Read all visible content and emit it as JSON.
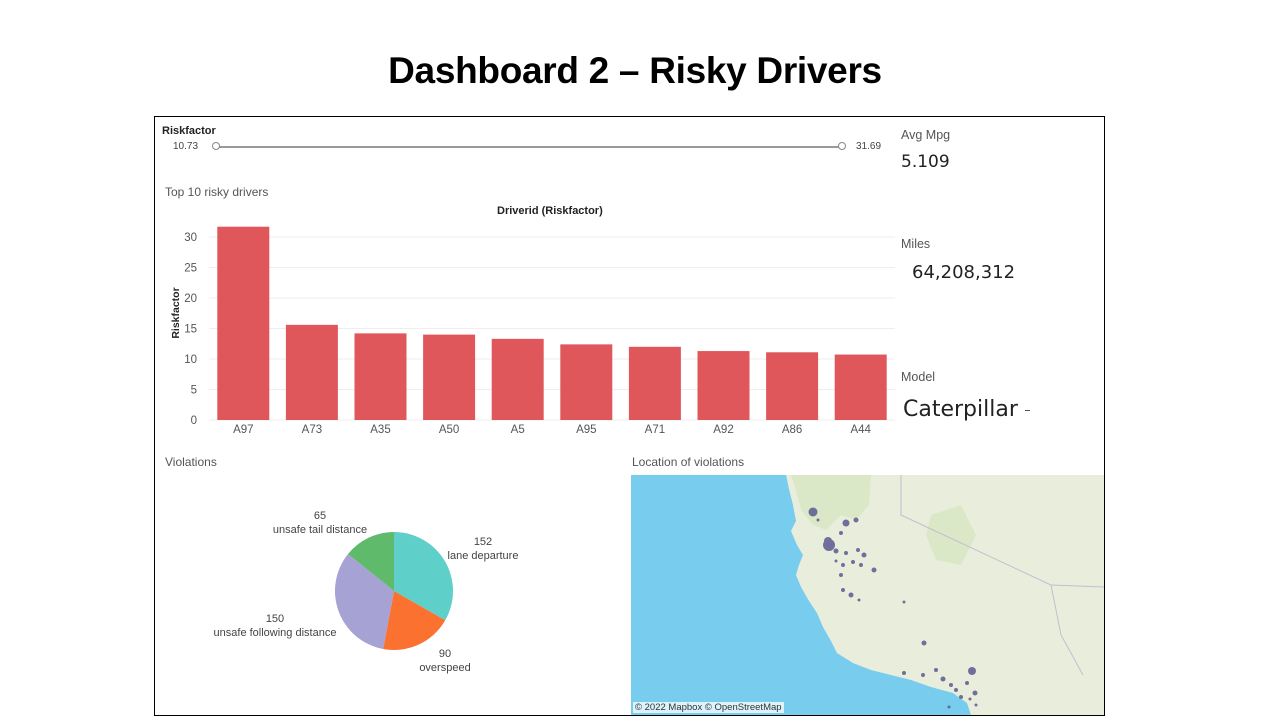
{
  "page_title": "Dashboard 2 – Risky Drivers",
  "filter": {
    "label": "Riskfactor",
    "min": "10.73",
    "max": "31.69"
  },
  "kpis": {
    "avg_mpg": {
      "label": "Avg Mpg",
      "value": "5.109"
    },
    "miles": {
      "label": "Miles",
      "value": "64,208,312"
    },
    "model": {
      "label": "Model",
      "value": "Caterpillar"
    }
  },
  "bar_section": {
    "title": "Top 10 risky drivers",
    "chart_title": "Driverid (Riskfactor)",
    "ylabel": "Riskfactor"
  },
  "violations_section": {
    "title": "Violations"
  },
  "map_section": {
    "title": "Location of violations",
    "attribution": "© 2022 Mapbox © OpenStreetMap"
  },
  "colors": {
    "bar": "#e0575b",
    "water": "#78cdee",
    "land": "#e9eedc",
    "dot": "#5b5a92"
  },
  "chart_data": [
    {
      "type": "bar",
      "title": "Driverid (Riskfactor)",
      "ylabel": "Riskfactor",
      "categories": [
        "A97",
        "A73",
        "A35",
        "A50",
        "A5",
        "A95",
        "A71",
        "A92",
        "A86",
        "A44"
      ],
      "values": [
        31.69,
        15.6,
        14.2,
        14.0,
        13.3,
        12.4,
        12.0,
        11.3,
        11.1,
        10.73
      ],
      "yticks": [
        0,
        5,
        10,
        15,
        20,
        25,
        30
      ],
      "ylim": [
        0,
        33
      ],
      "grid": true
    },
    {
      "type": "pie",
      "title": "",
      "slices": [
        {
          "label": "lane departure",
          "value": 152,
          "value_text": "152",
          "color": "#5ecfc9"
        },
        {
          "label": "overspeed",
          "value": 90,
          "value_text": "90",
          "color": "#fb7230"
        },
        {
          "label": "unsafe following distance",
          "value": 150,
          "value_text": "150",
          "color": "#a6a2d3"
        },
        {
          "label": "unsafe tail distance",
          "value": 65,
          "value_text": "65",
          "color": "#5fba6b"
        }
      ]
    }
  ]
}
